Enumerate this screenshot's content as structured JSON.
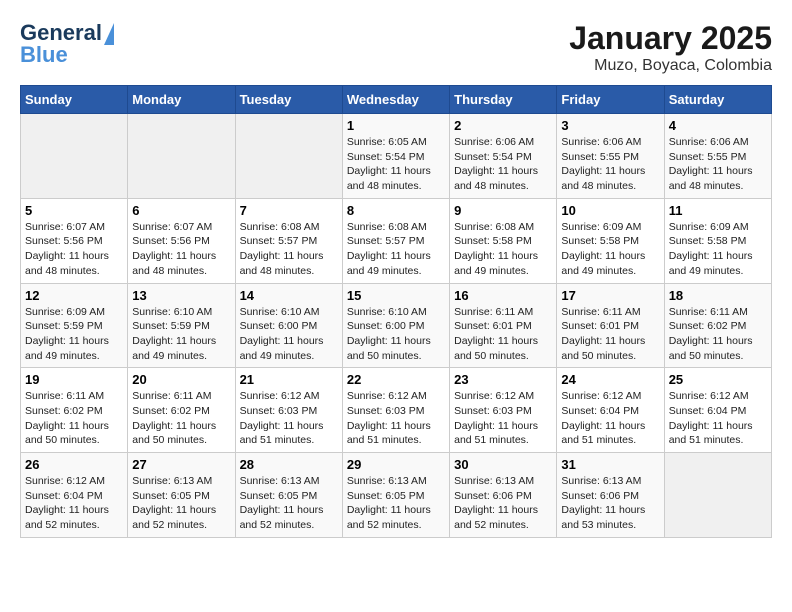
{
  "header": {
    "logo_line1": "General",
    "logo_line2": "Blue",
    "title": "January 2025",
    "subtitle": "Muzo, Boyaca, Colombia"
  },
  "weekdays": [
    "Sunday",
    "Monday",
    "Tuesday",
    "Wednesday",
    "Thursday",
    "Friday",
    "Saturday"
  ],
  "weeks": [
    [
      {
        "day": "",
        "info": ""
      },
      {
        "day": "",
        "info": ""
      },
      {
        "day": "",
        "info": ""
      },
      {
        "day": "1",
        "info": "Sunrise: 6:05 AM\nSunset: 5:54 PM\nDaylight: 11 hours and 48 minutes."
      },
      {
        "day": "2",
        "info": "Sunrise: 6:06 AM\nSunset: 5:54 PM\nDaylight: 11 hours and 48 minutes."
      },
      {
        "day": "3",
        "info": "Sunrise: 6:06 AM\nSunset: 5:55 PM\nDaylight: 11 hours and 48 minutes."
      },
      {
        "day": "4",
        "info": "Sunrise: 6:06 AM\nSunset: 5:55 PM\nDaylight: 11 hours and 48 minutes."
      }
    ],
    [
      {
        "day": "5",
        "info": "Sunrise: 6:07 AM\nSunset: 5:56 PM\nDaylight: 11 hours and 48 minutes."
      },
      {
        "day": "6",
        "info": "Sunrise: 6:07 AM\nSunset: 5:56 PM\nDaylight: 11 hours and 48 minutes."
      },
      {
        "day": "7",
        "info": "Sunrise: 6:08 AM\nSunset: 5:57 PM\nDaylight: 11 hours and 48 minutes."
      },
      {
        "day": "8",
        "info": "Sunrise: 6:08 AM\nSunset: 5:57 PM\nDaylight: 11 hours and 49 minutes."
      },
      {
        "day": "9",
        "info": "Sunrise: 6:08 AM\nSunset: 5:58 PM\nDaylight: 11 hours and 49 minutes."
      },
      {
        "day": "10",
        "info": "Sunrise: 6:09 AM\nSunset: 5:58 PM\nDaylight: 11 hours and 49 minutes."
      },
      {
        "day": "11",
        "info": "Sunrise: 6:09 AM\nSunset: 5:58 PM\nDaylight: 11 hours and 49 minutes."
      }
    ],
    [
      {
        "day": "12",
        "info": "Sunrise: 6:09 AM\nSunset: 5:59 PM\nDaylight: 11 hours and 49 minutes."
      },
      {
        "day": "13",
        "info": "Sunrise: 6:10 AM\nSunset: 5:59 PM\nDaylight: 11 hours and 49 minutes."
      },
      {
        "day": "14",
        "info": "Sunrise: 6:10 AM\nSunset: 6:00 PM\nDaylight: 11 hours and 49 minutes."
      },
      {
        "day": "15",
        "info": "Sunrise: 6:10 AM\nSunset: 6:00 PM\nDaylight: 11 hours and 50 minutes."
      },
      {
        "day": "16",
        "info": "Sunrise: 6:11 AM\nSunset: 6:01 PM\nDaylight: 11 hours and 50 minutes."
      },
      {
        "day": "17",
        "info": "Sunrise: 6:11 AM\nSunset: 6:01 PM\nDaylight: 11 hours and 50 minutes."
      },
      {
        "day": "18",
        "info": "Sunrise: 6:11 AM\nSunset: 6:02 PM\nDaylight: 11 hours and 50 minutes."
      }
    ],
    [
      {
        "day": "19",
        "info": "Sunrise: 6:11 AM\nSunset: 6:02 PM\nDaylight: 11 hours and 50 minutes."
      },
      {
        "day": "20",
        "info": "Sunrise: 6:11 AM\nSunset: 6:02 PM\nDaylight: 11 hours and 50 minutes."
      },
      {
        "day": "21",
        "info": "Sunrise: 6:12 AM\nSunset: 6:03 PM\nDaylight: 11 hours and 51 minutes."
      },
      {
        "day": "22",
        "info": "Sunrise: 6:12 AM\nSunset: 6:03 PM\nDaylight: 11 hours and 51 minutes."
      },
      {
        "day": "23",
        "info": "Sunrise: 6:12 AM\nSunset: 6:03 PM\nDaylight: 11 hours and 51 minutes."
      },
      {
        "day": "24",
        "info": "Sunrise: 6:12 AM\nSunset: 6:04 PM\nDaylight: 11 hours and 51 minutes."
      },
      {
        "day": "25",
        "info": "Sunrise: 6:12 AM\nSunset: 6:04 PM\nDaylight: 11 hours and 51 minutes."
      }
    ],
    [
      {
        "day": "26",
        "info": "Sunrise: 6:12 AM\nSunset: 6:04 PM\nDaylight: 11 hours and 52 minutes."
      },
      {
        "day": "27",
        "info": "Sunrise: 6:13 AM\nSunset: 6:05 PM\nDaylight: 11 hours and 52 minutes."
      },
      {
        "day": "28",
        "info": "Sunrise: 6:13 AM\nSunset: 6:05 PM\nDaylight: 11 hours and 52 minutes."
      },
      {
        "day": "29",
        "info": "Sunrise: 6:13 AM\nSunset: 6:05 PM\nDaylight: 11 hours and 52 minutes."
      },
      {
        "day": "30",
        "info": "Sunrise: 6:13 AM\nSunset: 6:06 PM\nDaylight: 11 hours and 52 minutes."
      },
      {
        "day": "31",
        "info": "Sunrise: 6:13 AM\nSunset: 6:06 PM\nDaylight: 11 hours and 53 minutes."
      },
      {
        "day": "",
        "info": ""
      }
    ]
  ]
}
